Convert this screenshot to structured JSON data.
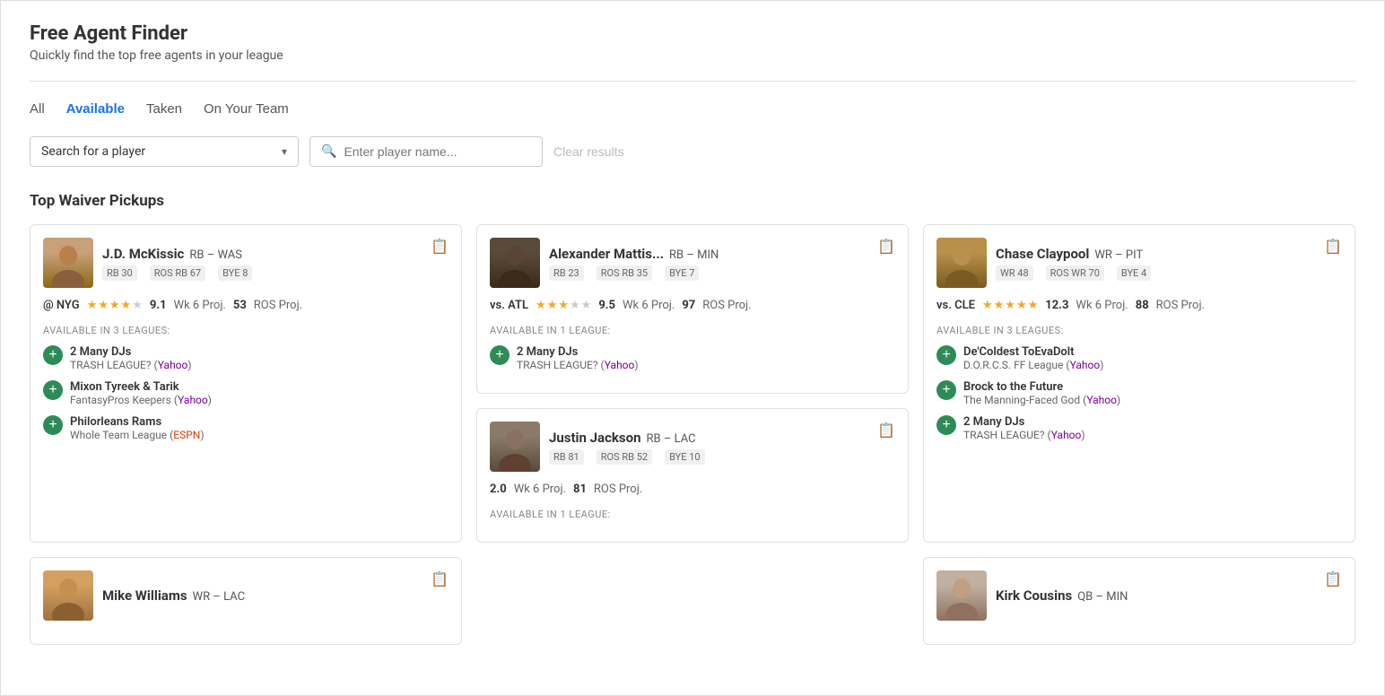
{
  "page": {
    "title": "Free Agent Finder",
    "subtitle": "Quickly find the top free agents in your league"
  },
  "filters": {
    "tabs": [
      {
        "id": "all",
        "label": "All",
        "active": false
      },
      {
        "id": "available",
        "label": "Available",
        "active": true
      },
      {
        "id": "taken",
        "label": "Taken",
        "active": false
      },
      {
        "id": "on-your-team",
        "label": "On Your Team",
        "active": false
      }
    ]
  },
  "search": {
    "dropdown_label": "Search for a player",
    "name_placeholder": "Enter player name...",
    "clear_label": "Clear results"
  },
  "section": {
    "title": "Top Waiver Pickups"
  },
  "players": [
    {
      "id": "jd-mckissic",
      "name": "J.D. McKissic",
      "name_bold": "J.D. McKissic",
      "position": "RB",
      "team": "WAS",
      "stat1": "RB 30",
      "stat2": "ROS RB 67",
      "stat3": "BYE 8",
      "opponent": "@ NYG",
      "stars": 4,
      "max_stars": 5,
      "wk_proj": "9.1",
      "wk_label": "Wk 6 Proj.",
      "ros_proj": "53",
      "ros_label": "ROS Proj.",
      "avail_text": "AVAILABLE IN 3 LEAGUES:",
      "avatar_class": "avatar-jd",
      "leagues": [
        {
          "name": "2 Many DJs",
          "sub_text": "TRASH LEAGUE?",
          "link_text": "Yahoo",
          "link_type": "yahoo"
        },
        {
          "name": "Mixon Tyreek & Tarik",
          "sub_text": "FantasyPros Keepers",
          "link_text": "Yahoo",
          "link_type": "yahoo"
        },
        {
          "name": "Philorleans Rams",
          "sub_text": "Whole Team League",
          "link_text": "ESPN",
          "link_type": "espn"
        }
      ]
    },
    {
      "id": "alexander-mattis",
      "name": "Alexander Mattis...",
      "name_bold": "Alexander Mattis...",
      "position": "RB",
      "team": "MIN",
      "stat1": "RB 23",
      "stat2": "ROS RB 35",
      "stat3": "BYE 7",
      "opponent": "vs. ATL",
      "stars": 3,
      "max_stars": 5,
      "wk_proj": "9.5",
      "wk_label": "Wk 6 Proj.",
      "ros_proj": "97",
      "ros_label": "ROS Proj.",
      "avail_text": "AVAILABLE IN 1 LEAGUE:",
      "avatar_class": "avatar-am",
      "leagues": [
        {
          "name": "2 Many DJs",
          "sub_text": "TRASH LEAGUE?",
          "link_text": "Yahoo",
          "link_type": "yahoo"
        }
      ]
    },
    {
      "id": "chase-claypool",
      "name": "Chase Claypool",
      "name_bold": "Chase Claypool",
      "position": "WR",
      "team": "PIT",
      "stat1": "WR 48",
      "stat2": "ROS WR 70",
      "stat3": "BYE 4",
      "opponent": "vs. CLE",
      "stars": 5,
      "max_stars": 5,
      "wk_proj": "12.3",
      "wk_label": "Wk 6 Proj.",
      "ros_proj": "88",
      "ros_label": "ROS Proj.",
      "avail_text": "AVAILABLE IN 3 LEAGUES:",
      "avatar_class": "avatar-cc",
      "leagues": [
        {
          "name": "De'Coldest ToEvaDolt",
          "sub_text": "D.O.R.C.S. FF League",
          "link_text": "Yahoo",
          "link_type": "yahoo"
        },
        {
          "name": "Brock to the Future",
          "sub_text": "The Manning-Faced God",
          "link_text": "Yahoo",
          "link_type": "yahoo"
        },
        {
          "name": "2 Many DJs",
          "sub_text": "TRASH LEAGUE?",
          "link_text": "Yahoo",
          "link_type": "yahoo"
        }
      ]
    },
    {
      "id": "justin-jackson",
      "name": "Justin Jackson",
      "name_bold": "Justin Jackson",
      "position": "RB",
      "team": "LAC",
      "stat1": "RB 81",
      "stat2": "ROS RB 52",
      "stat3": "BYE 10",
      "opponent": "",
      "stars": 0,
      "max_stars": 5,
      "wk_proj": "2.0",
      "wk_label": "Wk 6 Proj.",
      "ros_proj": "81",
      "ros_label": "ROS Proj.",
      "avail_text": "AVAILABLE IN 1 LEAGUE:",
      "avatar_class": "avatar-jj",
      "leagues": []
    }
  ],
  "bottom_players": [
    {
      "id": "mike-williams",
      "name": "Mike Williams",
      "position": "WR",
      "team": "LAC",
      "avatar_class": "avatar-mw"
    },
    {
      "id": "kirk-cousins",
      "name": "Kirk Cousins",
      "position": "QB",
      "team": "MIN",
      "avatar_class": "avatar-kc"
    }
  ],
  "icons": {
    "search": "🔍",
    "chevron": "▾",
    "report": "📋",
    "add": "+",
    "star_full": "★",
    "star_empty": "☆"
  }
}
